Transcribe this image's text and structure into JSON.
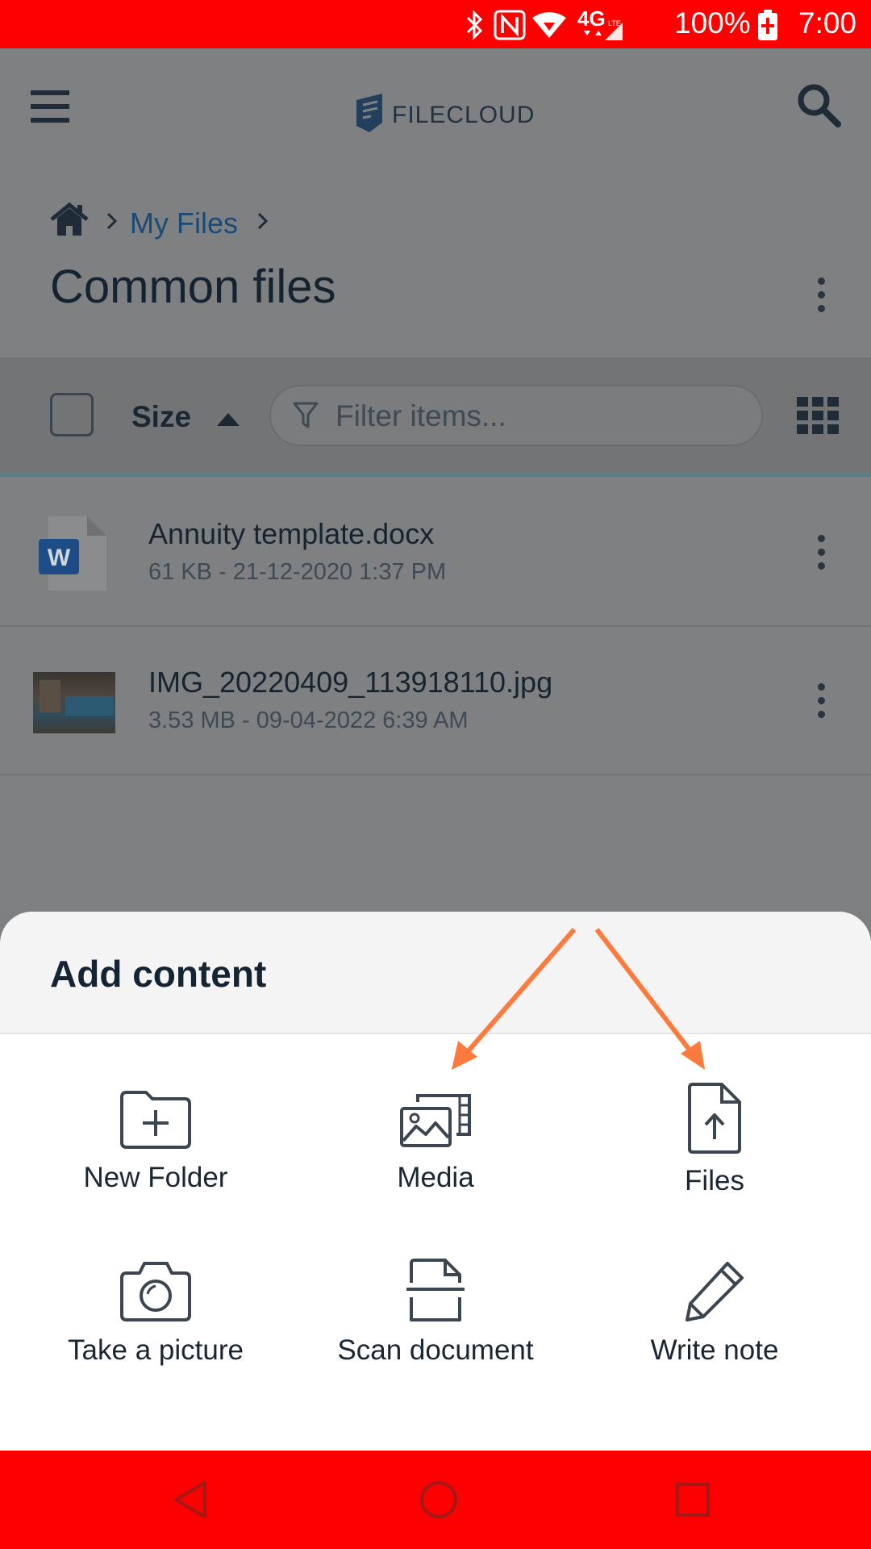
{
  "status_bar": {
    "battery": "100%",
    "time": "7:00",
    "network": "4G"
  },
  "header": {
    "logo_text": "FILECLOUD"
  },
  "breadcrumb": {
    "link": "My Files"
  },
  "page": {
    "title": "Common files"
  },
  "toolbar": {
    "sort_label": "Size",
    "filter_placeholder": "Filter items..."
  },
  "files": [
    {
      "name": "Annuity template.docx",
      "meta": "61 KB - 21-12-2020 1:37 PM",
      "icon": "word-document-icon"
    },
    {
      "name": "IMG_20220409_113918110.jpg",
      "meta": "3.53 MB - 09-04-2022 6:39 AM",
      "icon": "image-thumbnail"
    }
  ],
  "sheet": {
    "title": "Add content",
    "options": [
      {
        "label": "New Folder",
        "icon": "new-folder-icon"
      },
      {
        "label": "Media",
        "icon": "media-icon"
      },
      {
        "label": "Files",
        "icon": "file-upload-icon"
      },
      {
        "label": "Take a picture",
        "icon": "camera-icon"
      },
      {
        "label": "Scan document",
        "icon": "scan-document-icon"
      },
      {
        "label": "Write note",
        "icon": "pencil-icon"
      }
    ]
  },
  "colors": {
    "status_bar": "#ff0000",
    "nav_bar": "#ff0000",
    "annotation_arrow": "#ff7a3d",
    "word_blue": "#2b579a"
  }
}
